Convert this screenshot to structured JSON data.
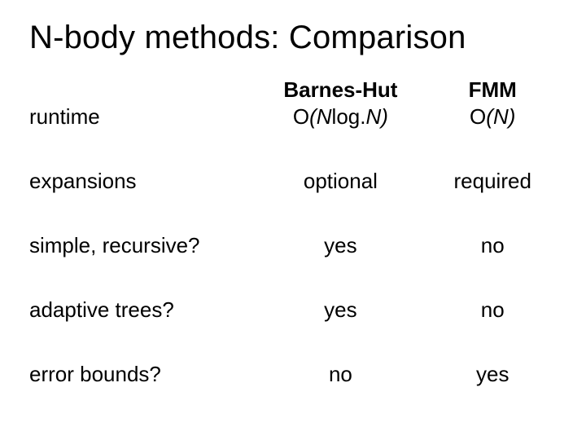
{
  "title": "N-body methods: Comparison",
  "columns": {
    "a": "Barnes-Hut",
    "b": "FMM"
  },
  "rows": {
    "runtime": {
      "label": "runtime",
      "a_html": "onlogn",
      "b_html": "on"
    },
    "expansions": {
      "label": "expansions",
      "a": "optional",
      "b": "required"
    },
    "simple": {
      "label": "simple, recursive?",
      "a": "yes",
      "b": "no"
    },
    "adaptive": {
      "label": "adaptive trees?",
      "a": "yes",
      "b": "no"
    },
    "error": {
      "label": "error bounds?",
      "a": "no",
      "b": "yes"
    }
  },
  "formulas": {
    "onlogn": "O(Nlog.N)",
    "on": "O(N)"
  }
}
